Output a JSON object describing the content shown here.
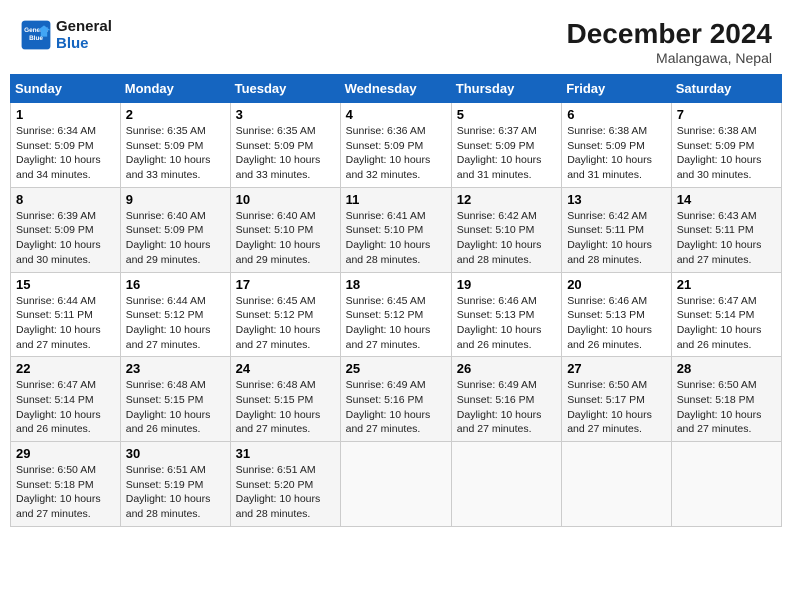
{
  "logo": {
    "line1": "General",
    "line2": "Blue"
  },
  "title": "December 2024",
  "location": "Malangawa, Nepal",
  "weekdays": [
    "Sunday",
    "Monday",
    "Tuesday",
    "Wednesday",
    "Thursday",
    "Friday",
    "Saturday"
  ],
  "weeks": [
    [
      {
        "day": "1",
        "info": "Sunrise: 6:34 AM\nSunset: 5:09 PM\nDaylight: 10 hours\nand 34 minutes."
      },
      {
        "day": "2",
        "info": "Sunrise: 6:35 AM\nSunset: 5:09 PM\nDaylight: 10 hours\nand 33 minutes."
      },
      {
        "day": "3",
        "info": "Sunrise: 6:35 AM\nSunset: 5:09 PM\nDaylight: 10 hours\nand 33 minutes."
      },
      {
        "day": "4",
        "info": "Sunrise: 6:36 AM\nSunset: 5:09 PM\nDaylight: 10 hours\nand 32 minutes."
      },
      {
        "day": "5",
        "info": "Sunrise: 6:37 AM\nSunset: 5:09 PM\nDaylight: 10 hours\nand 31 minutes."
      },
      {
        "day": "6",
        "info": "Sunrise: 6:38 AM\nSunset: 5:09 PM\nDaylight: 10 hours\nand 31 minutes."
      },
      {
        "day": "7",
        "info": "Sunrise: 6:38 AM\nSunset: 5:09 PM\nDaylight: 10 hours\nand 30 minutes."
      }
    ],
    [
      {
        "day": "8",
        "info": "Sunrise: 6:39 AM\nSunset: 5:09 PM\nDaylight: 10 hours\nand 30 minutes."
      },
      {
        "day": "9",
        "info": "Sunrise: 6:40 AM\nSunset: 5:09 PM\nDaylight: 10 hours\nand 29 minutes."
      },
      {
        "day": "10",
        "info": "Sunrise: 6:40 AM\nSunset: 5:10 PM\nDaylight: 10 hours\nand 29 minutes."
      },
      {
        "day": "11",
        "info": "Sunrise: 6:41 AM\nSunset: 5:10 PM\nDaylight: 10 hours\nand 28 minutes."
      },
      {
        "day": "12",
        "info": "Sunrise: 6:42 AM\nSunset: 5:10 PM\nDaylight: 10 hours\nand 28 minutes."
      },
      {
        "day": "13",
        "info": "Sunrise: 6:42 AM\nSunset: 5:11 PM\nDaylight: 10 hours\nand 28 minutes."
      },
      {
        "day": "14",
        "info": "Sunrise: 6:43 AM\nSunset: 5:11 PM\nDaylight: 10 hours\nand 27 minutes."
      }
    ],
    [
      {
        "day": "15",
        "info": "Sunrise: 6:44 AM\nSunset: 5:11 PM\nDaylight: 10 hours\nand 27 minutes."
      },
      {
        "day": "16",
        "info": "Sunrise: 6:44 AM\nSunset: 5:12 PM\nDaylight: 10 hours\nand 27 minutes."
      },
      {
        "day": "17",
        "info": "Sunrise: 6:45 AM\nSunset: 5:12 PM\nDaylight: 10 hours\nand 27 minutes."
      },
      {
        "day": "18",
        "info": "Sunrise: 6:45 AM\nSunset: 5:12 PM\nDaylight: 10 hours\nand 27 minutes."
      },
      {
        "day": "19",
        "info": "Sunrise: 6:46 AM\nSunset: 5:13 PM\nDaylight: 10 hours\nand 26 minutes."
      },
      {
        "day": "20",
        "info": "Sunrise: 6:46 AM\nSunset: 5:13 PM\nDaylight: 10 hours\nand 26 minutes."
      },
      {
        "day": "21",
        "info": "Sunrise: 6:47 AM\nSunset: 5:14 PM\nDaylight: 10 hours\nand 26 minutes."
      }
    ],
    [
      {
        "day": "22",
        "info": "Sunrise: 6:47 AM\nSunset: 5:14 PM\nDaylight: 10 hours\nand 26 minutes."
      },
      {
        "day": "23",
        "info": "Sunrise: 6:48 AM\nSunset: 5:15 PM\nDaylight: 10 hours\nand 26 minutes."
      },
      {
        "day": "24",
        "info": "Sunrise: 6:48 AM\nSunset: 5:15 PM\nDaylight: 10 hours\nand 27 minutes."
      },
      {
        "day": "25",
        "info": "Sunrise: 6:49 AM\nSunset: 5:16 PM\nDaylight: 10 hours\nand 27 minutes."
      },
      {
        "day": "26",
        "info": "Sunrise: 6:49 AM\nSunset: 5:16 PM\nDaylight: 10 hours\nand 27 minutes."
      },
      {
        "day": "27",
        "info": "Sunrise: 6:50 AM\nSunset: 5:17 PM\nDaylight: 10 hours\nand 27 minutes."
      },
      {
        "day": "28",
        "info": "Sunrise: 6:50 AM\nSunset: 5:18 PM\nDaylight: 10 hours\nand 27 minutes."
      }
    ],
    [
      {
        "day": "29",
        "info": "Sunrise: 6:50 AM\nSunset: 5:18 PM\nDaylight: 10 hours\nand 27 minutes."
      },
      {
        "day": "30",
        "info": "Sunrise: 6:51 AM\nSunset: 5:19 PM\nDaylight: 10 hours\nand 28 minutes."
      },
      {
        "day": "31",
        "info": "Sunrise: 6:51 AM\nSunset: 5:20 PM\nDaylight: 10 hours\nand 28 minutes."
      },
      null,
      null,
      null,
      null
    ]
  ]
}
